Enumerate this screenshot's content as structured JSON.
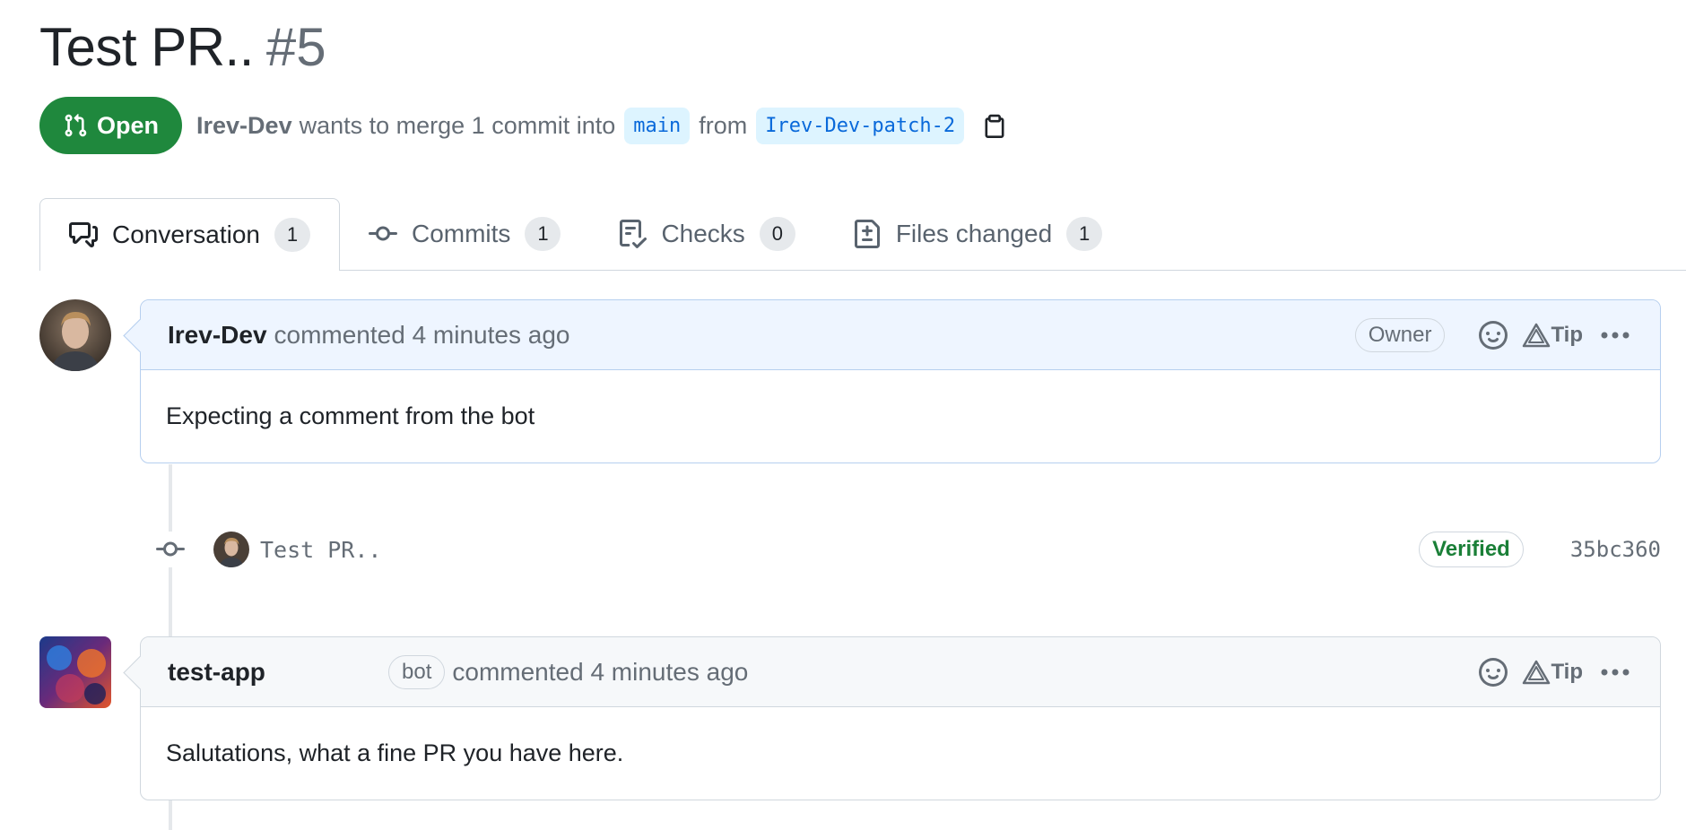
{
  "pr": {
    "title": "Test PR..",
    "number": "#5",
    "state": "Open",
    "author": "Irev-Dev",
    "merge_text": "wants to merge 1 commit into",
    "base_branch": "main",
    "from_text": "from",
    "head_branch": "Irev-Dev-patch-2"
  },
  "tabs": [
    {
      "label": "Conversation",
      "count": "1"
    },
    {
      "label": "Commits",
      "count": "1"
    },
    {
      "label": "Checks",
      "count": "0"
    },
    {
      "label": "Files changed",
      "count": "1"
    }
  ],
  "comments": [
    {
      "author": "Irev-Dev",
      "action": "commented 4 minutes ago",
      "role": "Owner",
      "tip_label": "Tip",
      "body": "Expecting a comment from the bot"
    },
    {
      "author": "test-app",
      "bot_label": "bot",
      "action": "commented 4 minutes ago",
      "tip_label": "Tip",
      "body": "Salutations, what a fine PR you have here."
    }
  ],
  "commit": {
    "message": "Test PR..",
    "verified_label": "Verified",
    "sha": "35bc360"
  },
  "colors": {
    "open_green": "#1f883d",
    "branch_blue": "#0969da",
    "verified_green": "#1a7f37"
  }
}
